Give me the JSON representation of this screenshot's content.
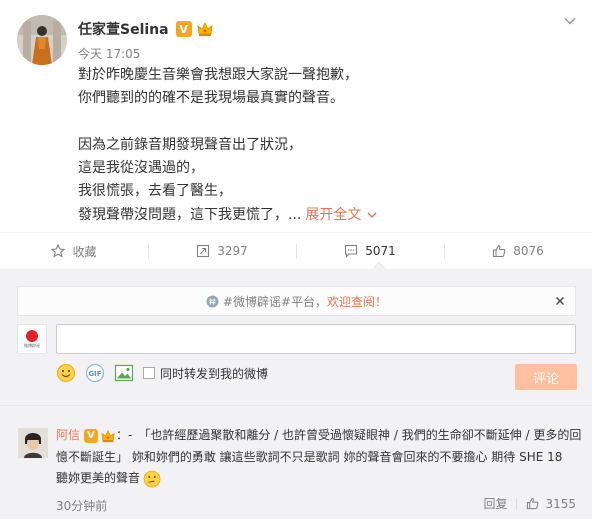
{
  "post": {
    "author": "任家萱Selina",
    "verified_badge": "V",
    "time": "今天 17:05",
    "lines": [
      "對於昨晚慶生音樂會我想跟大家說一聲抱歉，",
      "你們聽到的的確不是我現場最真實的聲音。",
      "",
      "因為之前錄音期發現聲音出了狀況，",
      "這是我從沒遇過的，",
      "我很慌張，去看了醫生，",
      "發現聲帶沒問題，這下我更慌了，..."
    ],
    "expand_label": "展开全文"
  },
  "actions": {
    "favorite_label": "收藏",
    "repost_count": "3297",
    "comment_count": "5071",
    "like_count": "8076"
  },
  "comment_box": {
    "notice_hashtag": "#微博辟谣#平台，",
    "notice_link": "欢迎查阅！",
    "my_avatar_caption": "微博辟谣",
    "forward_label": "同时转发到我的微博",
    "submit_label": "评论"
  },
  "comment": {
    "user": "阿信",
    "verified_badge": "V",
    "separator": "：-",
    "lines": [
      "「也許經歷過聚散和離分 / 也許曾受過懷疑眼神 / 我們的生命卻不斷延伸 / 更多的回",
      "憶不斷誕生」  妳和妳們的勇敢  讓這些歌詞不只是歌詞  妳的聲音會回來的不要擔心  期待 SHE 18",
      "聽妳更美的聲音"
    ],
    "time": "30分钟前",
    "reply_label": "回复",
    "like_count": "3155"
  },
  "colors": {
    "accent": "#eb7350",
    "submit_bg": "#ffc09f",
    "verified": "#f6a623",
    "comment_area_bg": "#f2f2f5"
  }
}
